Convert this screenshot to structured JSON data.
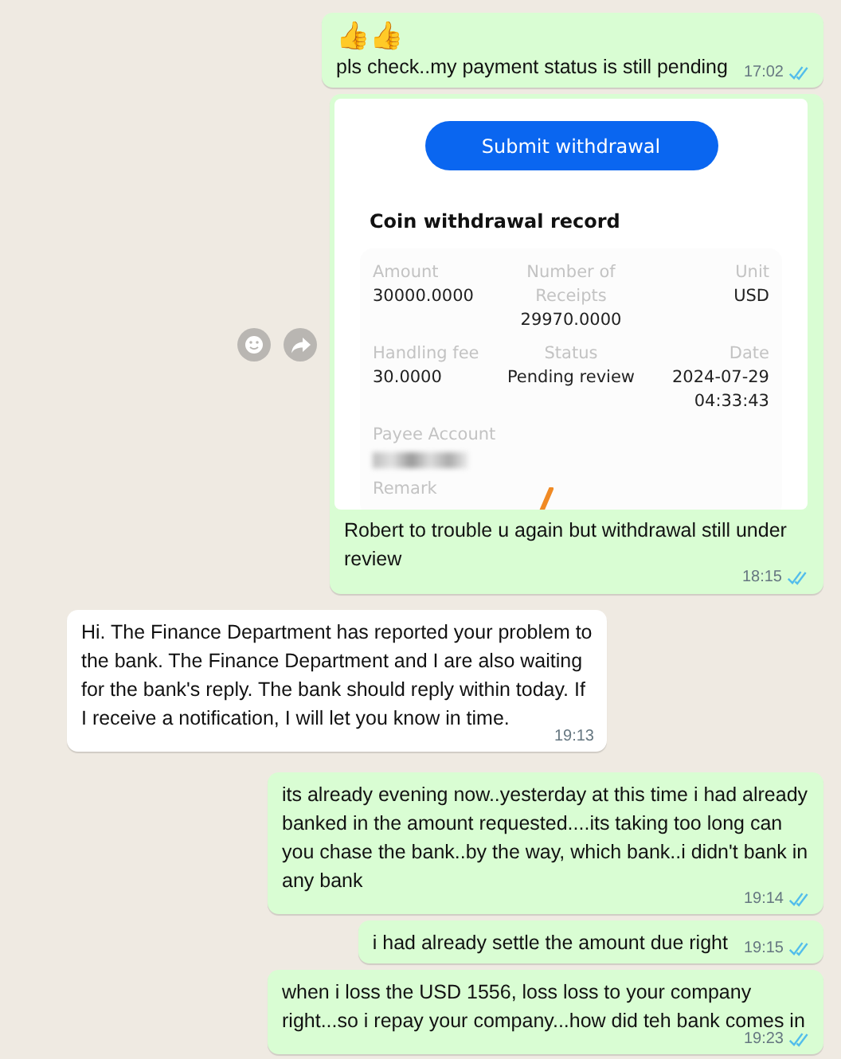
{
  "messages": [
    {
      "kind": "text",
      "outgoing": true,
      "emoji": "👍👍",
      "text": "pls check..my payment status is still pending",
      "time": "17:02",
      "read": true
    },
    {
      "kind": "image",
      "outgoing": true,
      "show_actions": true,
      "button": "Submit withdrawal",
      "record": {
        "title": "Coin withdrawal record",
        "fields": [
          {
            "label": "Amount",
            "value": "30000.0000"
          },
          {
            "label": "Number of Receipts",
            "value": "29970.0000"
          },
          {
            "label": "Unit",
            "value": "USD"
          },
          {
            "label": "Handling fee",
            "value": "30.0000"
          },
          {
            "label": "Status",
            "value": "Pending review"
          },
          {
            "label": "Date",
            "value": "2024-07-29 04:33:43"
          },
          {
            "label": "Payee Account",
            "redacted": true
          },
          {
            "label": "Remark"
          }
        ]
      },
      "caption": "Robert to trouble u again but withdrawal still under review",
      "time": "18:15",
      "read": true
    },
    {
      "kind": "text",
      "outgoing": false,
      "text": "Hi. The Finance Department has reported your problem to the bank. The Finance Department and I are also waiting for the bank's reply. The bank should reply within today. If I receive a notification, I will let you know in time.",
      "time": "19:13",
      "read": false
    },
    {
      "kind": "text",
      "outgoing": true,
      "text": "its already evening now..yesterday at this time i had already banked in the amount requested....its taking too long can you chase the bank..by the way, which bank..i didn't bank in any bank",
      "time": "19:14",
      "read": true
    },
    {
      "kind": "text",
      "outgoing": true,
      "text": "i had already settle the amount due right",
      "time": "19:15",
      "read": true
    },
    {
      "kind": "text",
      "outgoing": true,
      "text": "when i loss the USD 1556, loss loss to your company right...so i repay your company...how did teh bank comes in",
      "time": "19:23",
      "read": true
    }
  ]
}
